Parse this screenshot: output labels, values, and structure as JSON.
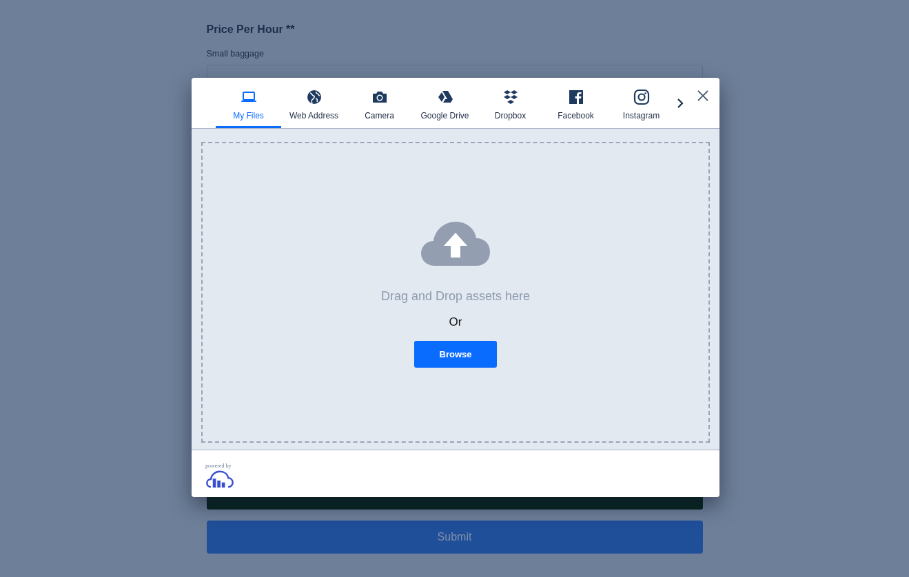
{
  "form": {
    "heading": "Price Per Hour **",
    "field_label": "Small baggage",
    "submit": "Submit"
  },
  "dialog": {
    "tabs": [
      {
        "label": "My Files",
        "kind": "laptop",
        "selected": true
      },
      {
        "label": "Web Address",
        "kind": "globe",
        "selected": false
      },
      {
        "label": "Camera",
        "kind": "camera",
        "selected": false
      },
      {
        "label": "Google Drive",
        "kind": "drive",
        "selected": false
      },
      {
        "label": "Dropbox",
        "kind": "dropbox",
        "selected": false
      },
      {
        "label": "Facebook",
        "kind": "facebook",
        "selected": false
      },
      {
        "label": "Instagram",
        "kind": "instagram",
        "selected": false
      }
    ],
    "dropzone": {
      "prompt": "Drag and Drop assets here",
      "or": "Or",
      "button": "Browse"
    },
    "footer": {
      "powered_by": "powered by"
    }
  }
}
